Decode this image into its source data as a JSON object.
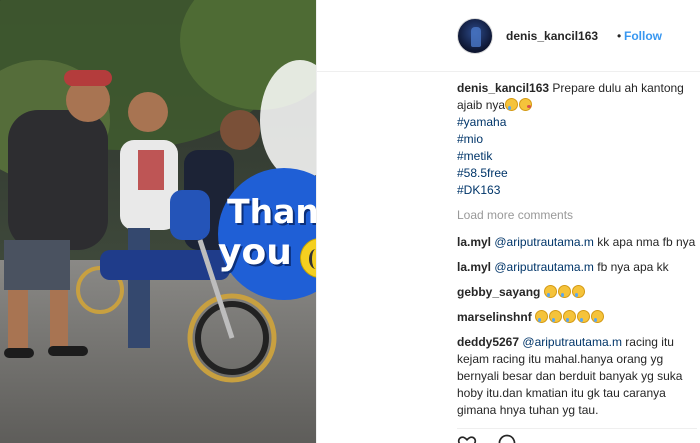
{
  "post": {
    "username": "denis_kancil163",
    "separator": "•",
    "follow_label": "Follow",
    "caption_user": "denis_kancil163",
    "caption_text": "Prepare dulu ah kantong ajaib nya",
    "hashtags": [
      "#yamaha",
      "#mio",
      "#metik",
      "#58.5free",
      "#DK163"
    ],
    "load_more": "Load more comments"
  },
  "sticker": {
    "line1": "Thank",
    "line2": "you"
  },
  "comments": [
    {
      "user": "la.myl",
      "mention": "@ariputrautama.m",
      "text": " kk apa nma fb nya"
    },
    {
      "user": "la.myl",
      "mention": "@ariputrautama.m",
      "text": " fb nya apa kk"
    },
    {
      "user": "gebby_sayang",
      "mention": "",
      "text": "",
      "emoji_count": 3
    },
    {
      "user": "marselinshnf",
      "mention": "",
      "text": "",
      "emoji_count": 5
    },
    {
      "user": "deddy5267",
      "mention": "@ariputrautama.m",
      "text": " racing itu kejam racing itu mahal.hanya orang yg bernyali besar dan berduit banyak yg suka hoby itu.dan kmatian itu gk tau caranya gimana hnya tuhan yg tau."
    }
  ],
  "icons": {
    "like": "heart-icon",
    "comment": "comment-icon"
  },
  "colors": {
    "link": "#003569",
    "follow": "#3897f0",
    "muted": "#999999",
    "sticker": "#1f5fd6"
  }
}
